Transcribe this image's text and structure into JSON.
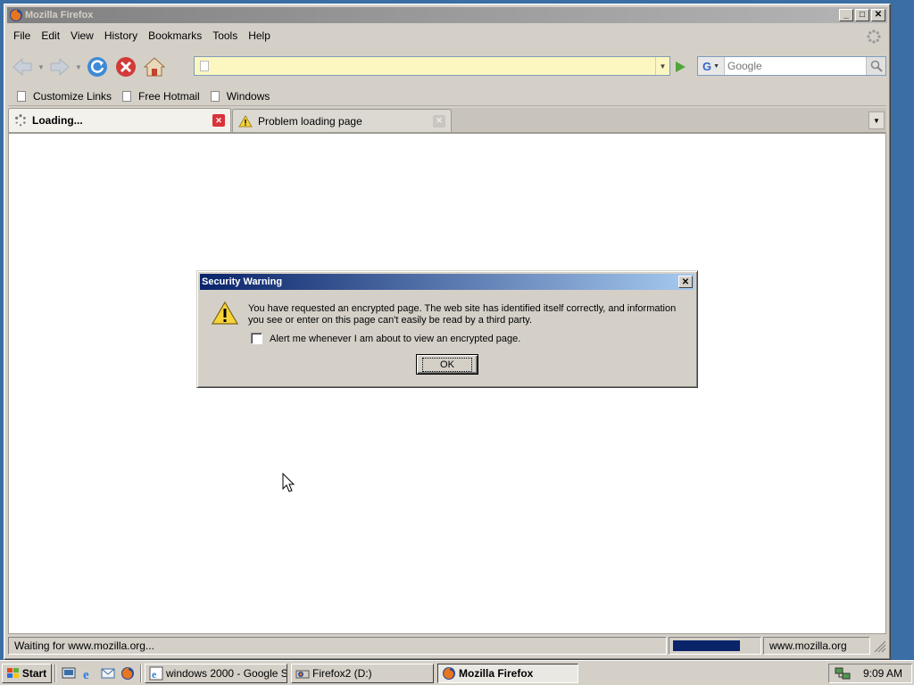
{
  "window": {
    "title": "Mozilla Firefox"
  },
  "menu": [
    "File",
    "Edit",
    "View",
    "History",
    "Bookmarks",
    "Tools",
    "Help"
  ],
  "urlbar": {
    "value": ""
  },
  "search": {
    "engine": "G",
    "placeholder": "Google"
  },
  "bookmarks": [
    "Customize Links",
    "Free Hotmail",
    "Windows"
  ],
  "tabs": [
    {
      "label": "Loading..."
    },
    {
      "label": "Problem loading page"
    }
  ],
  "status": {
    "text": "Waiting for www.mozilla.org...",
    "host": "www.mozilla.org",
    "progress_fraction": 0.8
  },
  "dialog": {
    "title": "Security Warning",
    "message": "You have requested an encrypted page. The web site has identified itself correctly, and information you see or enter on this page can't easily be read by a third party.",
    "checkbox_label": "Alert me whenever I am about to view an encrypted page.",
    "checkbox_checked": false,
    "ok_label": "OK"
  },
  "taskbar": {
    "start_label": "Start",
    "tasks": [
      {
        "label": "windows 2000 - Google S..."
      },
      {
        "label": "Firefox2 (D:)"
      },
      {
        "label": "Mozilla Firefox"
      }
    ],
    "clock": "9:09 AM"
  },
  "colors": {
    "desktop": "#3a6ea5",
    "dialog_title_start": "#0a246a",
    "dialog_title_end": "#a6caf0",
    "urlbar_bg": "#fcf6c1",
    "tab_close_active": "#d9333a"
  }
}
